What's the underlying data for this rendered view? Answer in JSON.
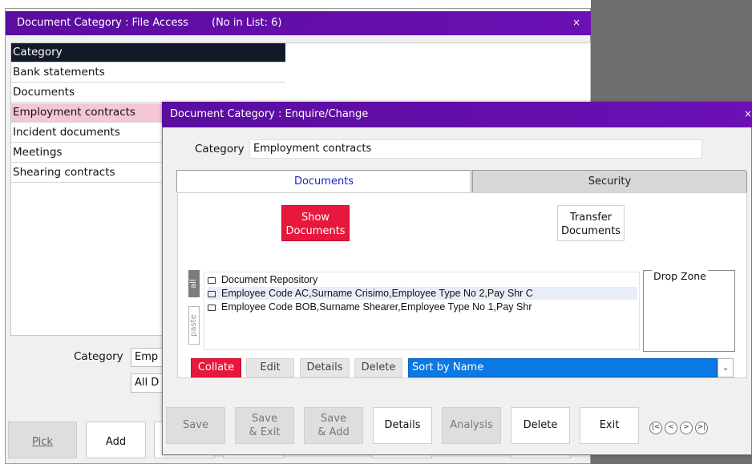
{
  "outer": {
    "title": "Document Category : File Access",
    "count": "(No in List: 6)",
    "close": "×",
    "list": {
      "header": "Category",
      "items": [
        "Bank statements",
        "Documents",
        "Employment contracts",
        "Incident documents",
        "Meetings",
        "Shearing contracts"
      ],
      "selected": "Employment contracts"
    },
    "filter": {
      "category_label": "Category",
      "category_value": "Emp",
      "second_value": "All D"
    },
    "buttons": {
      "pick": "Pick",
      "add": "Add"
    }
  },
  "inner": {
    "title": "Document Category : Enquire/Change",
    "close": "×",
    "category_label": "Category",
    "category_value": "Employment contracts",
    "tabs": [
      "Documents",
      "Security"
    ],
    "show_documents": [
      "Show",
      "Documents"
    ],
    "transfer_documents": [
      "Transfer",
      "Documents"
    ],
    "side_tabs": {
      "all": "all",
      "paste": "paste"
    },
    "tree": [
      "Document Repository",
      "Employee Code AC,Surname Crisimo,Employee Type No 2,Pay Shr C",
      "Employee Code BOB,Surname Shearer,Employee Type No 1,Pay Shr"
    ],
    "drop_zone": "Drop Zone",
    "row_buttons": {
      "collate": "Collate",
      "edit": "Edit",
      "details": "Details",
      "delete": "Delete"
    },
    "sort": {
      "value": "Sort by Name",
      "arrow": "⌄"
    },
    "bottom_buttons": {
      "save": "Save",
      "save_exit": [
        "Save",
        "& Exit"
      ],
      "save_add": [
        "Save",
        "& Add"
      ],
      "details": "Details",
      "analysis": "Analysis",
      "delete": "Delete",
      "exit": "Exit"
    },
    "nav": [
      "|<",
      "<",
      ">",
      ">|"
    ]
  },
  "colors": {
    "titlebar": "#6b10b4",
    "accent_red": "#e8173c",
    "select_blue": "#0b78e3",
    "list_header": "#121a2a",
    "list_selected": "#f5c7d5"
  }
}
